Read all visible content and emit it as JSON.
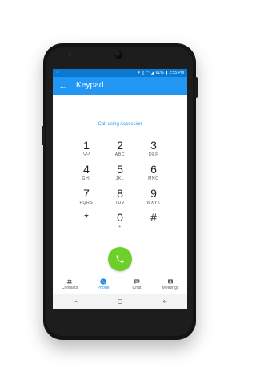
{
  "status_bar": {
    "left_icons": [
      "notification-icon",
      "wifi-icon"
    ],
    "battery_text": "61%",
    "time_text": "2:55 PM"
  },
  "app_bar": {
    "title": "Keypad",
    "back_icon": "arrow-left-icon"
  },
  "call_using_text": "Call using Accession",
  "keypad": {
    "keys": [
      {
        "digit": "1",
        "letters": "QO"
      },
      {
        "digit": "2",
        "letters": "ABC"
      },
      {
        "digit": "3",
        "letters": "DEF"
      },
      {
        "digit": "4",
        "letters": "GHI"
      },
      {
        "digit": "5",
        "letters": "JKL"
      },
      {
        "digit": "6",
        "letters": "MNO"
      },
      {
        "digit": "7",
        "letters": "PQRS"
      },
      {
        "digit": "8",
        "letters": "TUV"
      },
      {
        "digit": "9",
        "letters": "WXYZ"
      },
      {
        "digit": "*",
        "letters": ""
      },
      {
        "digit": "0",
        "letters": "+"
      },
      {
        "digit": "#",
        "letters": ""
      }
    ]
  },
  "call_button": {
    "icon": "phone-icon",
    "color": "#6ccf2a"
  },
  "bottom_nav": {
    "items": [
      {
        "label": "Contacts",
        "icon": "contacts-icon",
        "active": false
      },
      {
        "label": "Phone",
        "icon": "phone-icon",
        "active": true
      },
      {
        "label": "Chat",
        "icon": "chat-icon",
        "active": false
      },
      {
        "label": "Meetings",
        "icon": "meetings-icon",
        "active": false
      }
    ]
  },
  "system_nav": {
    "buttons": [
      "recent-apps-icon",
      "home-icon",
      "back-icon"
    ]
  },
  "colors": {
    "status_bar": "#0b79d0",
    "app_bar": "#2196f3",
    "accent": "#2196f3",
    "call_button": "#6ccf2a"
  }
}
